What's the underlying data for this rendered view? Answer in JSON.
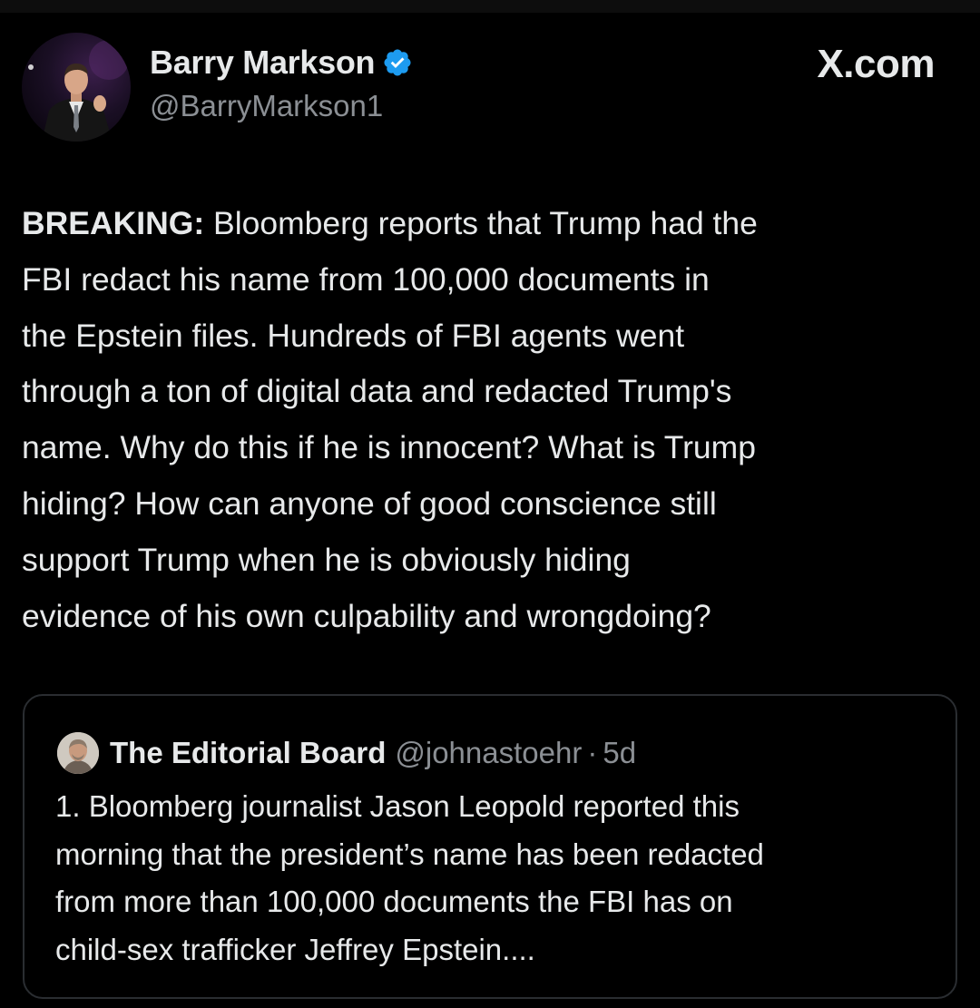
{
  "tweet": {
    "author": {
      "display_name": "Barry Markson",
      "handle": "@BarryMarkson1",
      "verified": true
    },
    "brand": "X.com",
    "text_bold_prefix": "BREAKING:",
    "text_lines": [
      " Bloomberg reports that Trump had the",
      "FBI redact his name from 100,000 documents in",
      "the Epstein files. Hundreds of FBI agents went",
      "through a ton of digital data and redacted Trump's",
      "name. Why do this if he is innocent? What is Trump",
      "hiding? How can anyone of good conscience still",
      "support Trump when he is obviously hiding",
      "evidence of his own culpability and wrongdoing?"
    ]
  },
  "quoted_tweet": {
    "display_name": "The Editorial Board",
    "handle": "@johnastoehr",
    "separator": "·",
    "time": "5d",
    "text_lines": [
      "1. Bloomberg journalist Jason Leopold reported this",
      "morning that the president’s name has been redacted",
      "from more than 100,000 documents the FBI has on",
      "child-sex trafficker Jeffrey Epstein...."
    ]
  },
  "colors": {
    "background": "#000000",
    "text_primary": "#e7e9ea",
    "text_secondary": "#8b8f94",
    "verified_blue": "#1d9bf0",
    "quote_border": "#2a2d31"
  },
  "icons": {
    "verified": "verified-badge-icon",
    "author_avatar": "avatar",
    "quote_avatar": "avatar"
  }
}
